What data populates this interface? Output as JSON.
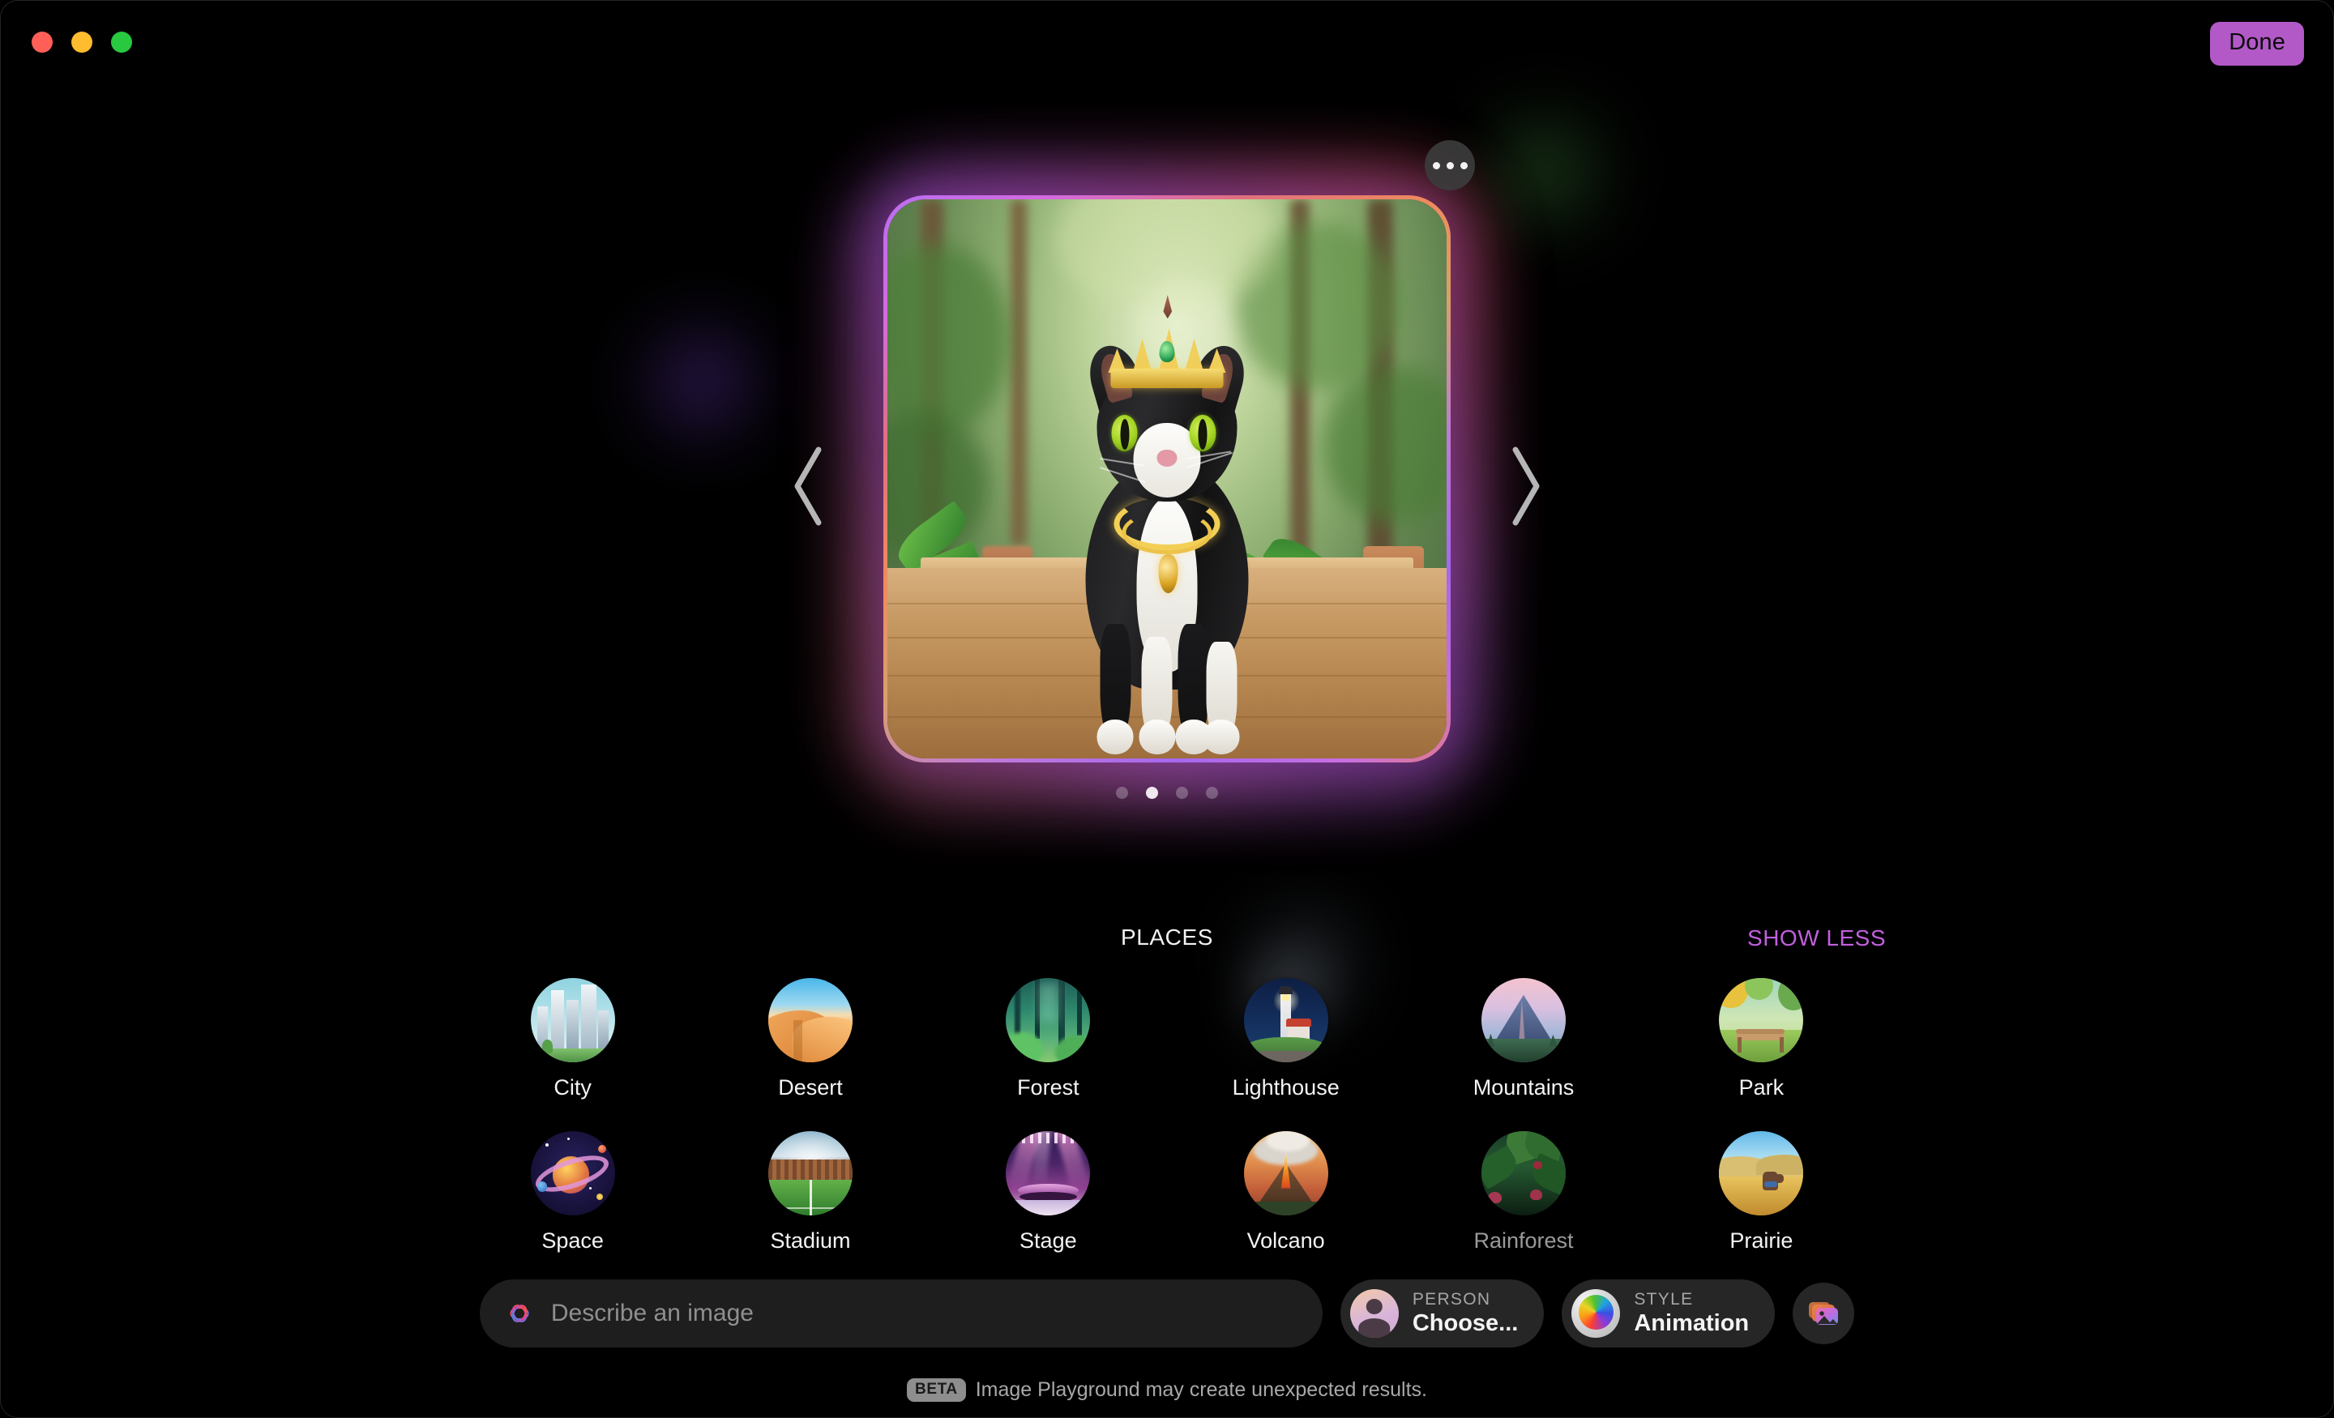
{
  "window": {
    "traffic_lights": [
      {
        "name": "close",
        "color": "#ff5f57"
      },
      {
        "name": "minimize",
        "color": "#febc2e"
      },
      {
        "name": "zoom",
        "color": "#28c840"
      }
    ],
    "done_label": "Done",
    "done_color": "#b259c7"
  },
  "hero": {
    "menu_icon": "ellipsis-icon",
    "prev_icon": "chevron-left-icon",
    "next_icon": "chevron-right-icon",
    "image_description": "Animated-style tuxedo cat wearing a gold crown and gold necklace standing on a wooden floor in a lush green jungle conservatory",
    "page_dots": {
      "count": 4,
      "active_index": 1
    }
  },
  "places": {
    "title": "PLACES",
    "show_less_label": "SHOW LESS",
    "show_less_color": "#c060dd",
    "items": [
      {
        "label": "City",
        "icon": "city-thumbnail",
        "dimmed": false
      },
      {
        "label": "Desert",
        "icon": "desert-thumbnail",
        "dimmed": false
      },
      {
        "label": "Forest",
        "icon": "forest-thumbnail",
        "dimmed": false
      },
      {
        "label": "Lighthouse",
        "icon": "lighthouse-thumbnail",
        "dimmed": false
      },
      {
        "label": "Mountains",
        "icon": "mountains-thumbnail",
        "dimmed": false
      },
      {
        "label": "Park",
        "icon": "park-thumbnail",
        "dimmed": false
      },
      {
        "label": "Space",
        "icon": "space-thumbnail",
        "dimmed": false
      },
      {
        "label": "Stadium",
        "icon": "stadium-thumbnail",
        "dimmed": false
      },
      {
        "label": "Stage",
        "icon": "stage-thumbnail",
        "dimmed": false
      },
      {
        "label": "Volcano",
        "icon": "volcano-thumbnail",
        "dimmed": false
      },
      {
        "label": "Rainforest",
        "icon": "rainforest-thumbnail",
        "dimmed": true
      },
      {
        "label": "Prairie",
        "icon": "prairie-thumbnail",
        "dimmed": false
      }
    ]
  },
  "toolbar": {
    "prompt": {
      "value": "",
      "placeholder": "Describe an image",
      "icon": "apple-intelligence-icon"
    },
    "person_chip": {
      "kicker": "PERSON",
      "value": "Choose...",
      "icon": "person-avatar-icon"
    },
    "style_chip": {
      "kicker": "STYLE",
      "value": "Animation",
      "icon": "style-ball-icon"
    },
    "photo_button_icon": "photos-library-icon"
  },
  "footer": {
    "badge": "BETA",
    "text": "Image Playground may create unexpected results."
  }
}
